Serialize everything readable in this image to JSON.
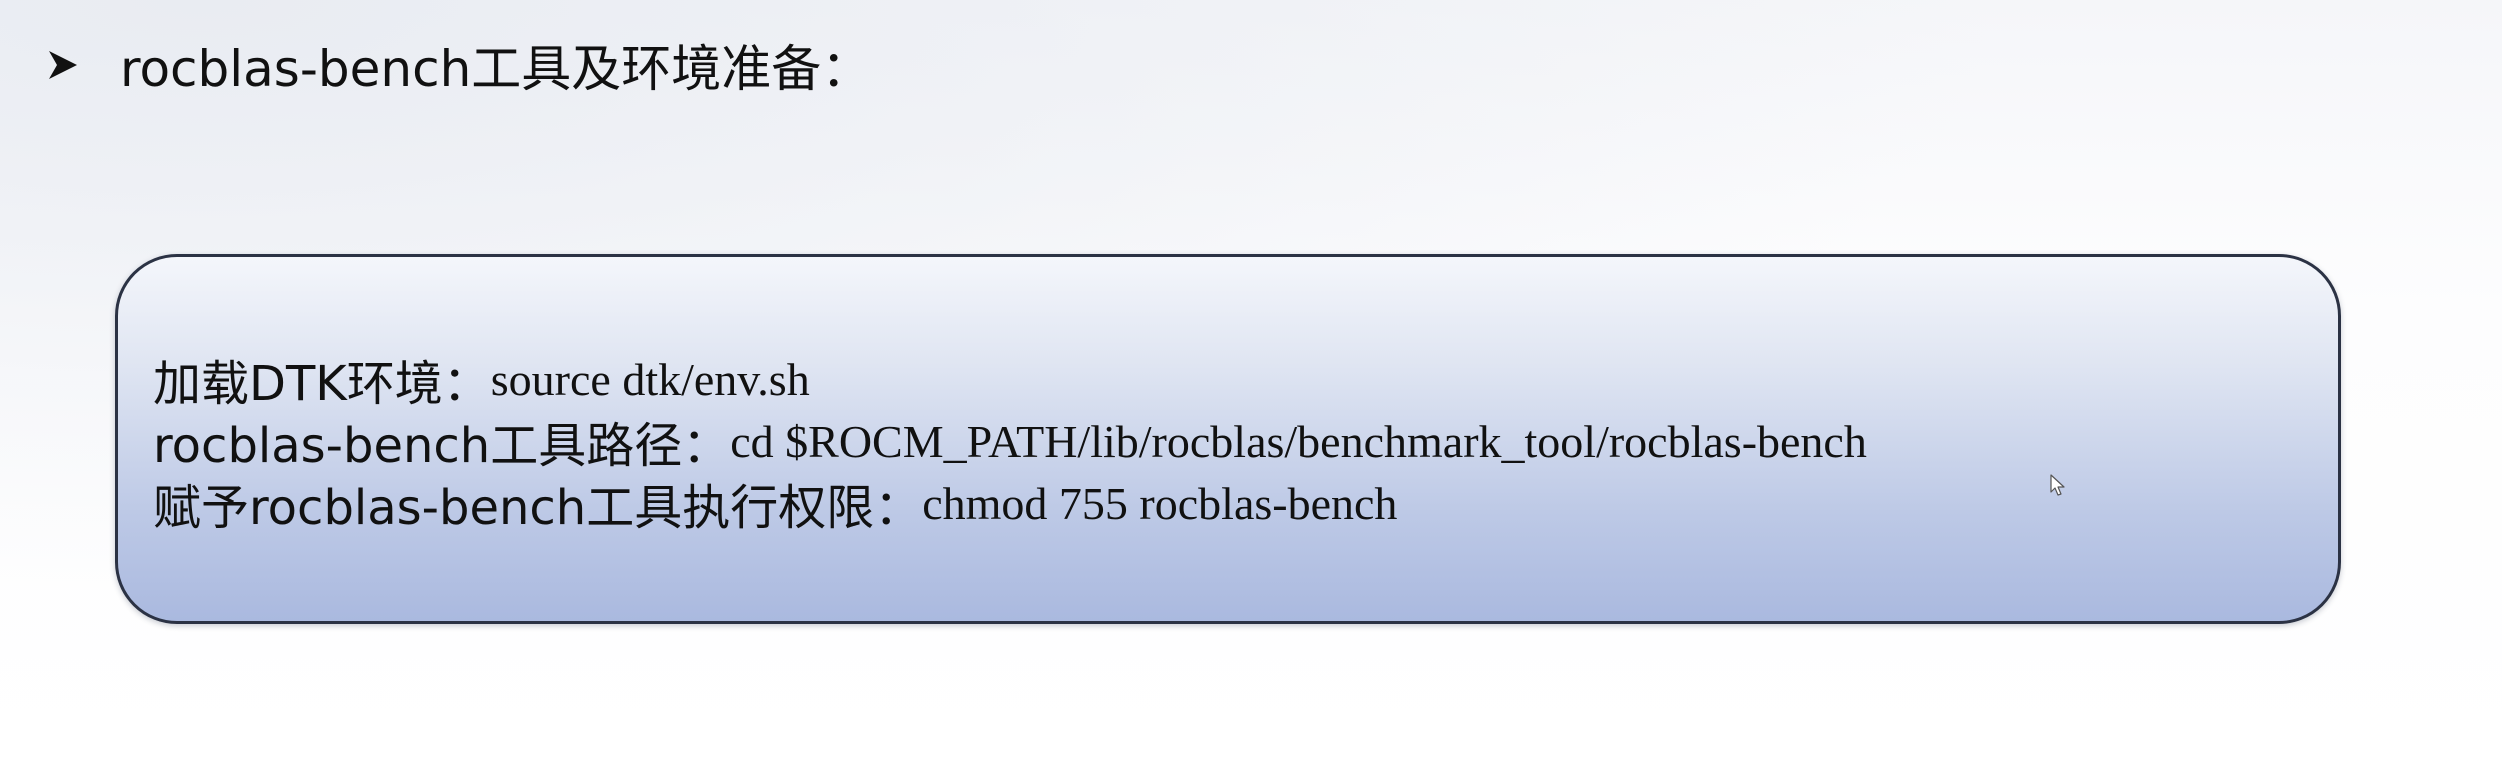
{
  "heading": {
    "bullet_icon": "arrowhead-bullet-icon",
    "text": "rocblas-bench工具及环境准备："
  },
  "box": {
    "lines": [
      {
        "label": "加载DTK环境：",
        "command": "source dtk/env.sh"
      },
      {
        "label": "rocblas-bench工具路径：",
        "command": "cd $ROCM_PATH/lib/rocblas/benchmark_tool/rocblas-bench"
      },
      {
        "label": "赋予rocblas-bench工具执行权限：",
        "command": "chmod 755 rocblas-bench"
      }
    ]
  },
  "cursor_icon": "mouse-pointer-icon",
  "colors": {
    "box_border": "#2b3244",
    "box_fill_top": "#f4f6fb",
    "box_fill_bottom": "#aab9df",
    "text": "#111111"
  }
}
